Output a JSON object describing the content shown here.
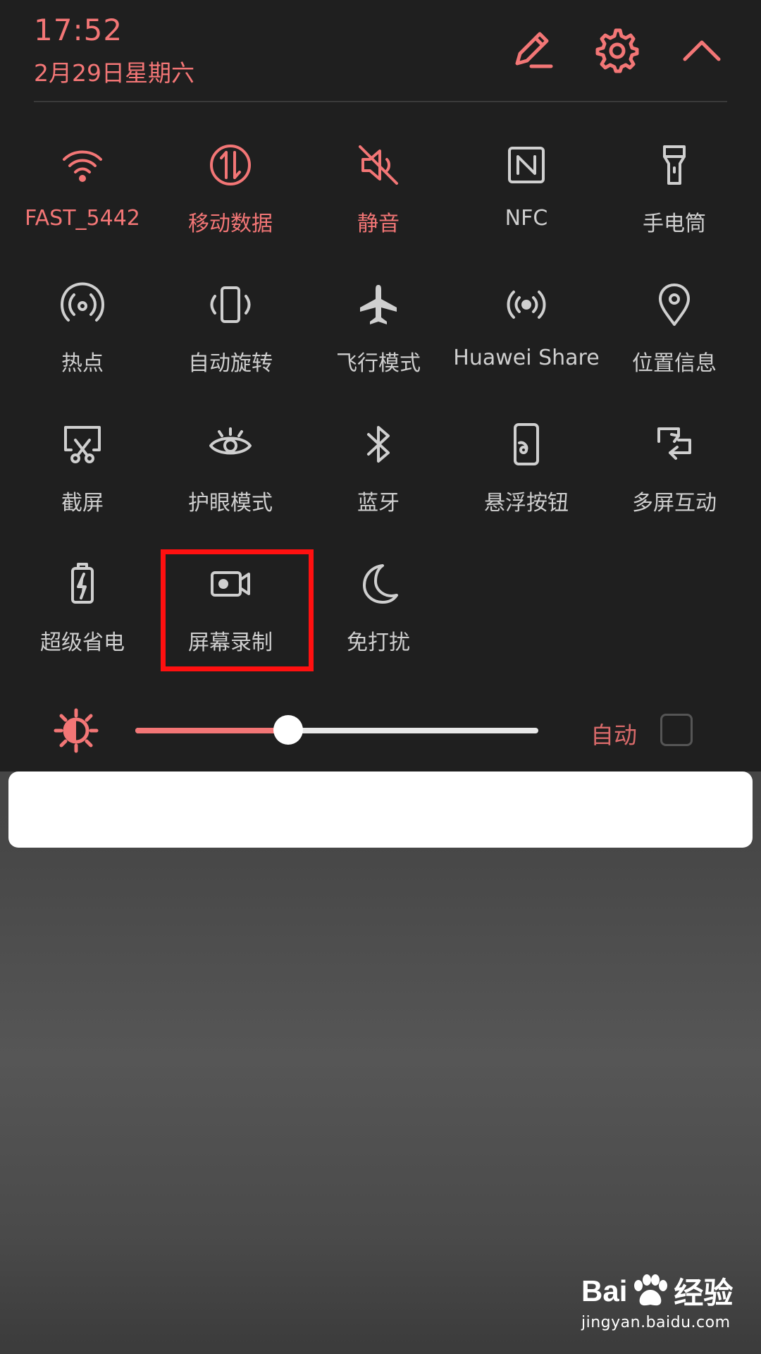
{
  "status": {
    "time": "17:52",
    "date": "2月29日星期六"
  },
  "header_icons": [
    "edit-icon",
    "settings-icon",
    "chevron-up-icon"
  ],
  "colors": {
    "accent": "#f37676",
    "tile_off": "#cfcfcf",
    "panel_bg": "#1f1f1f",
    "highlight": "#ff1010"
  },
  "tiles": [
    {
      "label": "FAST_5442",
      "icon": "wifi-icon",
      "active": true
    },
    {
      "label": "移动数据",
      "icon": "mobile-data-icon",
      "active": true
    },
    {
      "label": "静音",
      "icon": "mute-icon",
      "active": true
    },
    {
      "label": "NFC",
      "icon": "nfc-icon",
      "active": false
    },
    {
      "label": "手电筒",
      "icon": "flashlight-icon",
      "active": false
    },
    {
      "label": "热点",
      "icon": "hotspot-icon",
      "active": false
    },
    {
      "label": "自动旋转",
      "icon": "auto-rotate-icon",
      "active": false
    },
    {
      "label": "飞行模式",
      "icon": "airplane-icon",
      "active": false
    },
    {
      "label": "Huawei Share",
      "icon": "huawei-share-icon",
      "active": false
    },
    {
      "label": "位置信息",
      "icon": "location-icon",
      "active": false
    },
    {
      "label": "截屏",
      "icon": "screenshot-icon",
      "active": false
    },
    {
      "label": "护眼模式",
      "icon": "eye-icon",
      "active": false
    },
    {
      "label": "蓝牙",
      "icon": "bluetooth-icon",
      "active": false
    },
    {
      "label": "悬浮按钮",
      "icon": "floating-button-icon",
      "active": false
    },
    {
      "label": "多屏互动",
      "icon": "multi-screen-icon",
      "active": false
    },
    {
      "label": "超级省电",
      "icon": "battery-saver-icon",
      "active": false
    },
    {
      "label": "屏幕录制",
      "icon": "screen-record-icon",
      "active": false,
      "highlighted": true
    },
    {
      "label": "免打扰",
      "icon": "moon-icon",
      "active": false
    }
  ],
  "brightness": {
    "level": 0.38,
    "auto_label": "自动",
    "auto_checked": false
  },
  "watermark": {
    "logo": "Bai经验",
    "url": "jingyan.baidu.com"
  }
}
